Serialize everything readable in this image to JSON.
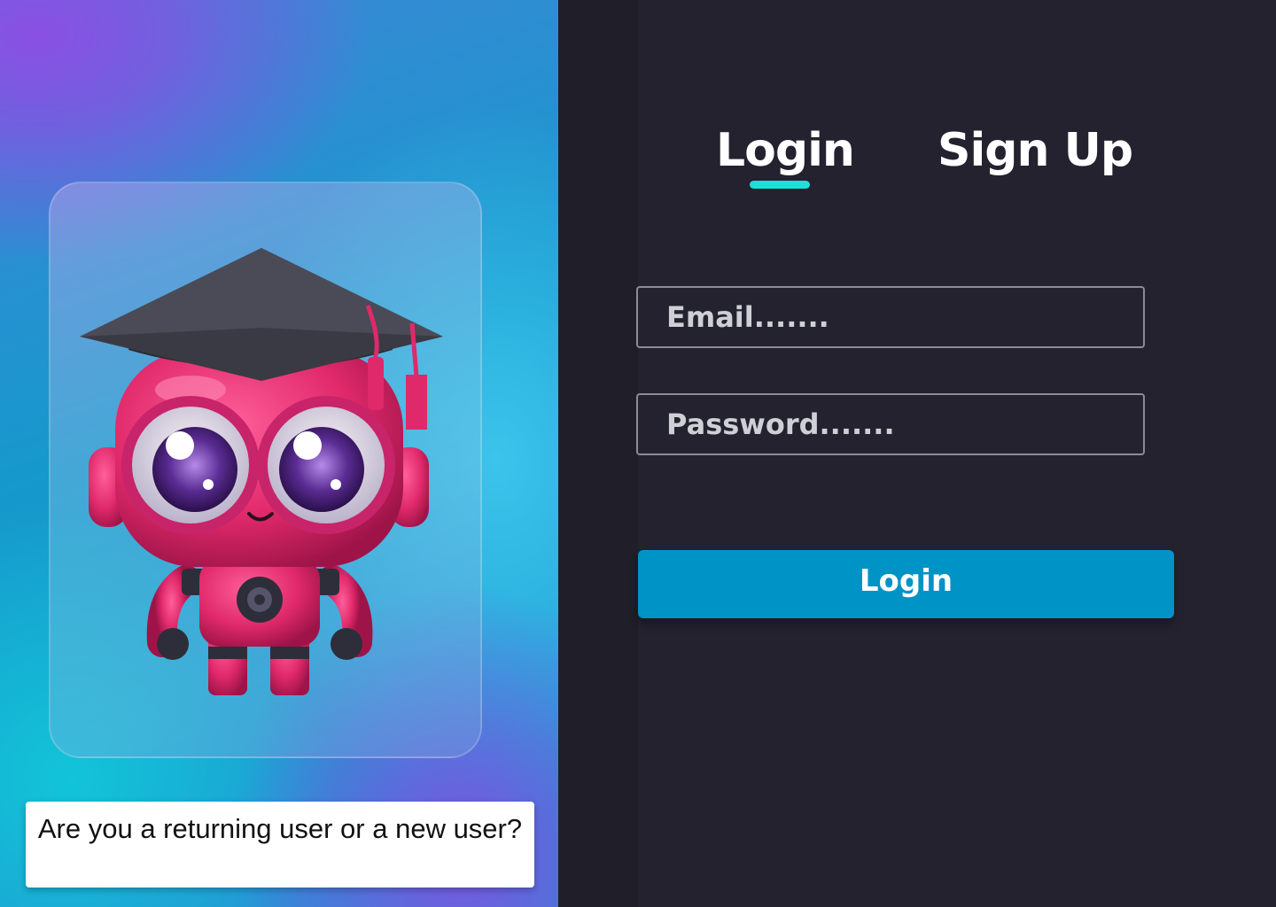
{
  "colors": {
    "left_gradient_purple": "#8a4fe3",
    "left_gradient_blue": "#1599cc",
    "right_background": "#23222e",
    "tab_underline": "#1de0d8",
    "button_primary": "#0093c6",
    "mascot_body": "#e8306f"
  },
  "hero": {
    "image": "graduation-robot-mascot",
    "question": "Are you a returning user or a new user?"
  },
  "auth": {
    "tabs": [
      {
        "label": "Login",
        "active": true
      },
      {
        "label": "Sign Up",
        "active": false
      }
    ],
    "email_placeholder": "Email.......",
    "password_placeholder": "Password.......",
    "submit_label": "Login"
  }
}
